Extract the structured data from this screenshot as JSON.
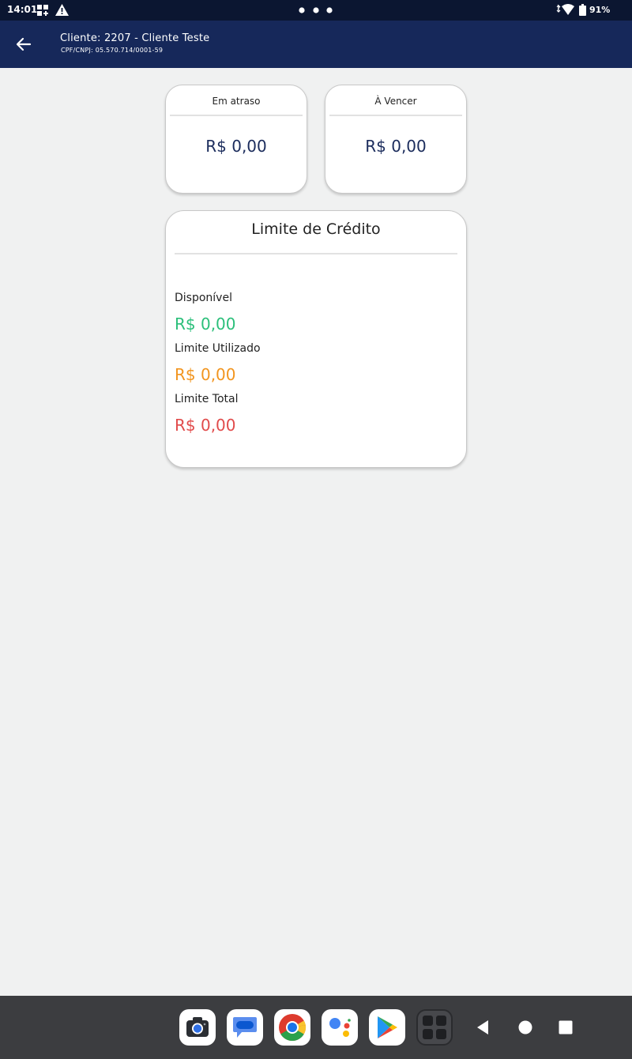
{
  "status_bar": {
    "time": "14:01",
    "battery": "91%",
    "icons": [
      "grid-icon",
      "warning-icon",
      "more-dots-icon",
      "wifi-icon",
      "battery-icon"
    ]
  },
  "app_bar": {
    "client_title": "Cliente: 2207 - Cliente Teste",
    "client_doc": "CPF/CNPJ: 05.570.714/0001-59"
  },
  "summary": {
    "overdue": {
      "label": "Em atraso",
      "value": "R$ 0,00"
    },
    "due": {
      "label": "À Vencer",
      "value": "R$ 0,00"
    }
  },
  "credit": {
    "title": "Limite de Crédito",
    "items": [
      {
        "label": "Disponível",
        "value": "R$ 0,00",
        "color": "#2bbf7a"
      },
      {
        "label": "Limite Utilizado",
        "value": "R$ 0,00",
        "color": "#f2951f"
      },
      {
        "label": "Limite Total",
        "value": "R$ 0,00",
        "color": "#e14b4b"
      }
    ]
  },
  "nav_bar": {
    "dock_apps": [
      "camera-app-icon",
      "messages-app-icon",
      "chrome-app-icon",
      "assistant-app-icon",
      "play-store-app-icon",
      "app-drawer-icon"
    ],
    "buttons": [
      "back-nav-icon",
      "home-nav-icon",
      "recents-nav-icon"
    ]
  }
}
